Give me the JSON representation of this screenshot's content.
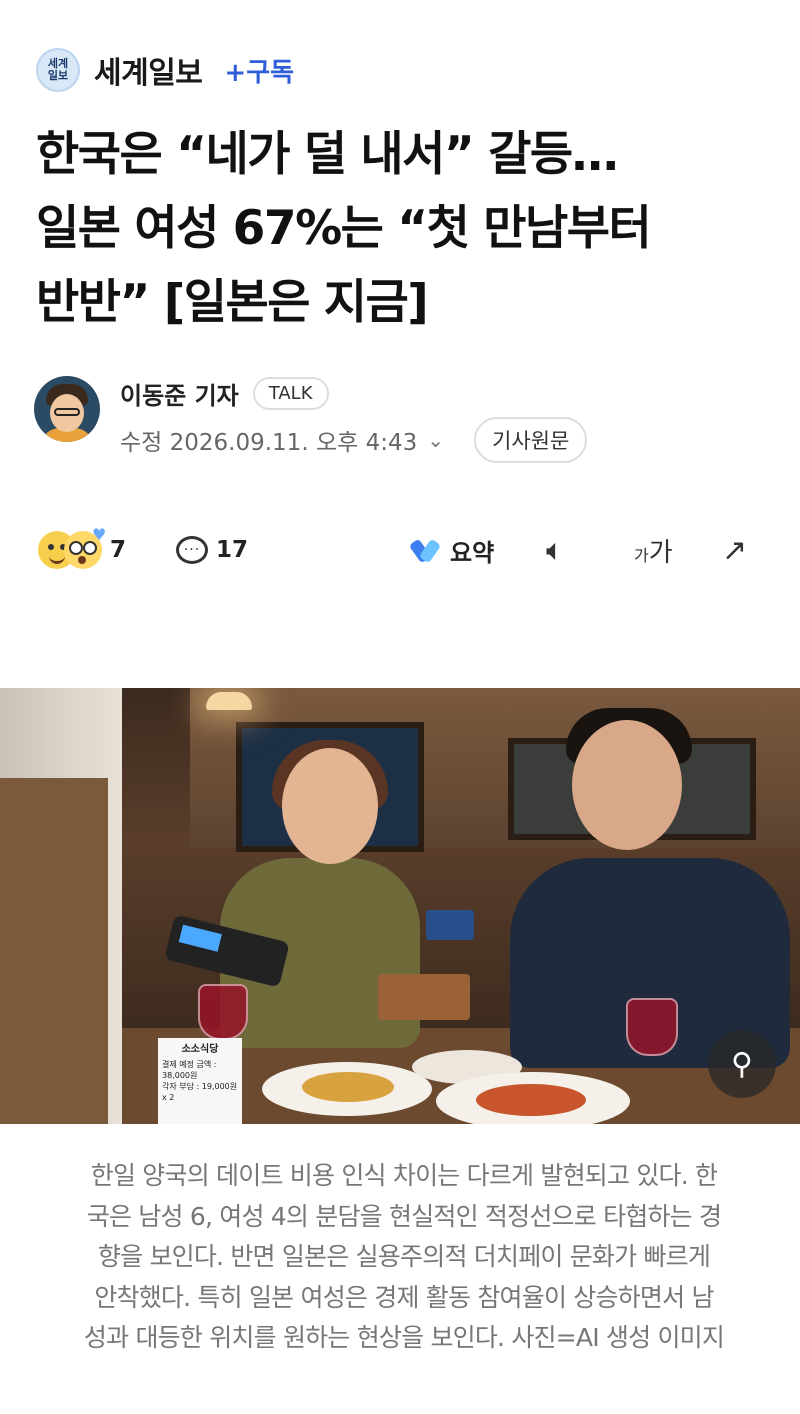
{
  "header": {
    "logo_line1": "세계",
    "logo_line2": "일보",
    "press_name": "세계일보",
    "subscribe_label": "+구독"
  },
  "article": {
    "title_lines": [
      "한국은 “네가 덜 내서” 갈등…",
      "일본 여성 67%는 “첫 만남부터",
      "반반” [일본은 지금]"
    ],
    "reporter": "이동준 기자",
    "talk_label": "TALK",
    "date": "수정 2026.09.11. 오후 4:43",
    "original_label": "기사원문"
  },
  "actions": {
    "reaction_count": "7",
    "comment_count": "17",
    "summary_label": "요약",
    "font_size_label_small": "가",
    "font_size_label_large": "가"
  },
  "photo": {
    "receipt_title": "소소식당",
    "receipt_line1": "결제 예정 금액 : 38,000원",
    "receipt_line2": "각자 부담 : 19,000원 x 2"
  },
  "caption_lines": [
    "한일 양국의 데이트 비용 인식 차이는 다르게 발현되고 있다. 한",
    "국은 남성 6, 여성 4의 분담을 현실적인 적정선으로 타협하는 경",
    "향을 보인다. 반면 일본은  실용주의적 더치페이 문화가 빠르게",
    "안착했다. 특히 일본 여성은 경제 활동 참여율이 상승하면서 남",
    "성과 대등한 위치를 원하는 현상을 보인다. 사진=AI 생성 이미지"
  ],
  "icons": {
    "reaction": "emoji-reaction-icon",
    "comment": "comment-bubble-icon",
    "summary": "ai-summary-icon",
    "speaker": "speaker-icon",
    "font": "font-size-icon",
    "share": "share-icon",
    "zoom": "zoom-icon"
  },
  "colors": {
    "subscribe": "#2f5fd8",
    "caption": "#777777"
  }
}
